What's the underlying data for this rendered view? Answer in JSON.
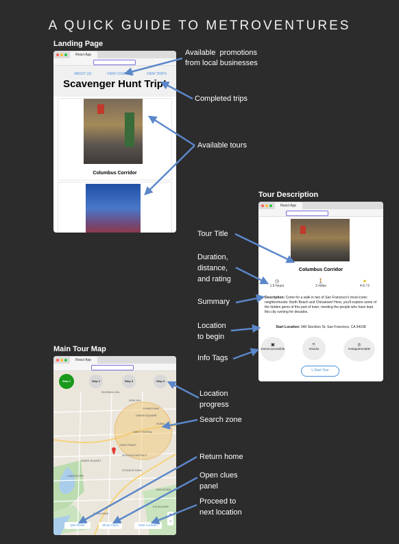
{
  "title": "A QUICK GUIDE TO METROVENTURES",
  "colors": {
    "background": "#2c2c2c",
    "arrow": "#5b87c9",
    "step_active": "#1a9a1a"
  },
  "landing": {
    "heading": "Landing Page",
    "tab": "React App",
    "nav": [
      "ABOUT US",
      "VIEW COUPONS",
      "VIEW TRIPS"
    ],
    "hunt_title": "Scavenger Hunt Trip!",
    "tour_name": "Columbus Corridor"
  },
  "tour": {
    "heading": "Tour Description",
    "tab": "React App",
    "tour_name": "Columbus Corridor",
    "stats": [
      "1.5 hours",
      "2 miles",
      "4.6 / 5"
    ],
    "description_label": "Description:",
    "description": "Come for a walk in two of San Francisco's most iconic neighborhoods: North Beach and Chinatown! Here, you'll explore some of the hidden gems of this part of town, meeting the people who have kept this city running for decades.",
    "start_label": "Start Location:",
    "start_value": "940 Stockton St, San Francisco, CA 94108",
    "tags": [
      "transit accessible",
      "Snacks",
      "Instagrammable"
    ],
    "button": "Start Tour"
  },
  "map": {
    "heading": "Main Tour Map",
    "tab": "React App",
    "steps": [
      "Step 1",
      "Step 2",
      "Step 3",
      "Step 4"
    ],
    "area_labels": [
      "RUSSIAN HILL",
      "NOB HILL",
      "CHINATOWN",
      "UNION SQUARE",
      "SOMA",
      "WEST PORTAL",
      "INNER SUNSET",
      "LAKESHORE",
      "INGLESIDE",
      "EXCELSIOR",
      "MISSION DISTRICT",
      "TWIN PEAKS",
      "STONESTOWN",
      "GLEN PARK"
    ],
    "buttons": [
      "Quit Route",
      "Show Clues",
      "Next Location"
    ]
  },
  "annotations": [
    "Available  promotions\nfrom local businesses",
    "Completed trips",
    "Available tours",
    "Tour Title",
    "Duration,\ndistance,\nand rating",
    "Summary",
    "Location\nto begin",
    "Info Tags",
    "Location\nprogress",
    "Search zone",
    "Return home",
    "Open clues\npanel",
    "Proceed to\nnext location"
  ]
}
